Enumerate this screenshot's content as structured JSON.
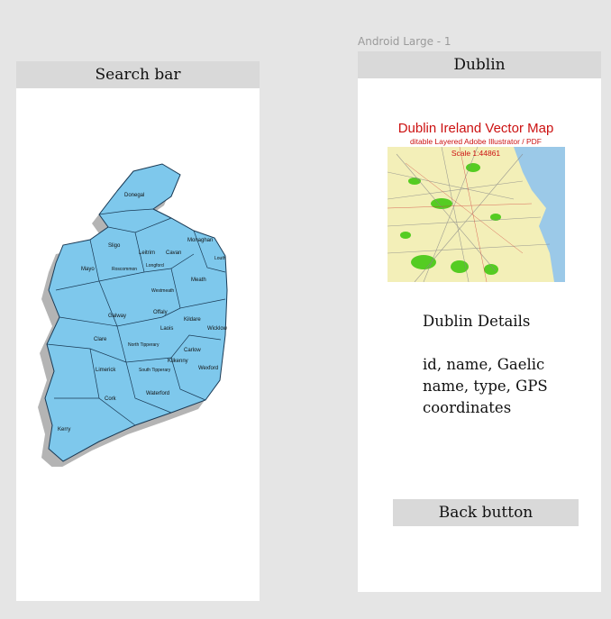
{
  "canvas": {
    "frame_label": "Android Large - 1"
  },
  "left_screen": {
    "search_bar": "Search bar",
    "map": {
      "counties": [
        "Donegal",
        "Sligo",
        "Leitrim",
        "Cavan",
        "Monaghan",
        "Mayo",
        "Roscommon",
        "Longford",
        "Meath",
        "Westmeath",
        "Galway",
        "Offaly",
        "Kildare",
        "Wicklow",
        "Clare",
        "North Tipperary",
        "Laois",
        "Carlow",
        "Limerick",
        "South Tipperary",
        "Kilkenny",
        "Wexford",
        "Cork",
        "Waterford",
        "Kerry",
        "Louth"
      ],
      "fill": "#7ec8ec"
    }
  },
  "right_screen": {
    "title": "Dublin",
    "image": {
      "title": "Dublin Ireland Vector Map",
      "subtitle": "ditable Layered Adobe Illustrator / PDF",
      "scale": "Scale 1:44861"
    },
    "details_title": "Dublin Details",
    "details_fields": "id, name, Gaelic name, type, GPS coordinates",
    "back_button": "Back button"
  },
  "colors": {
    "map_title": "#cc1111",
    "map_water": "#9bc9e8",
    "map_green": "#55cc22"
  }
}
